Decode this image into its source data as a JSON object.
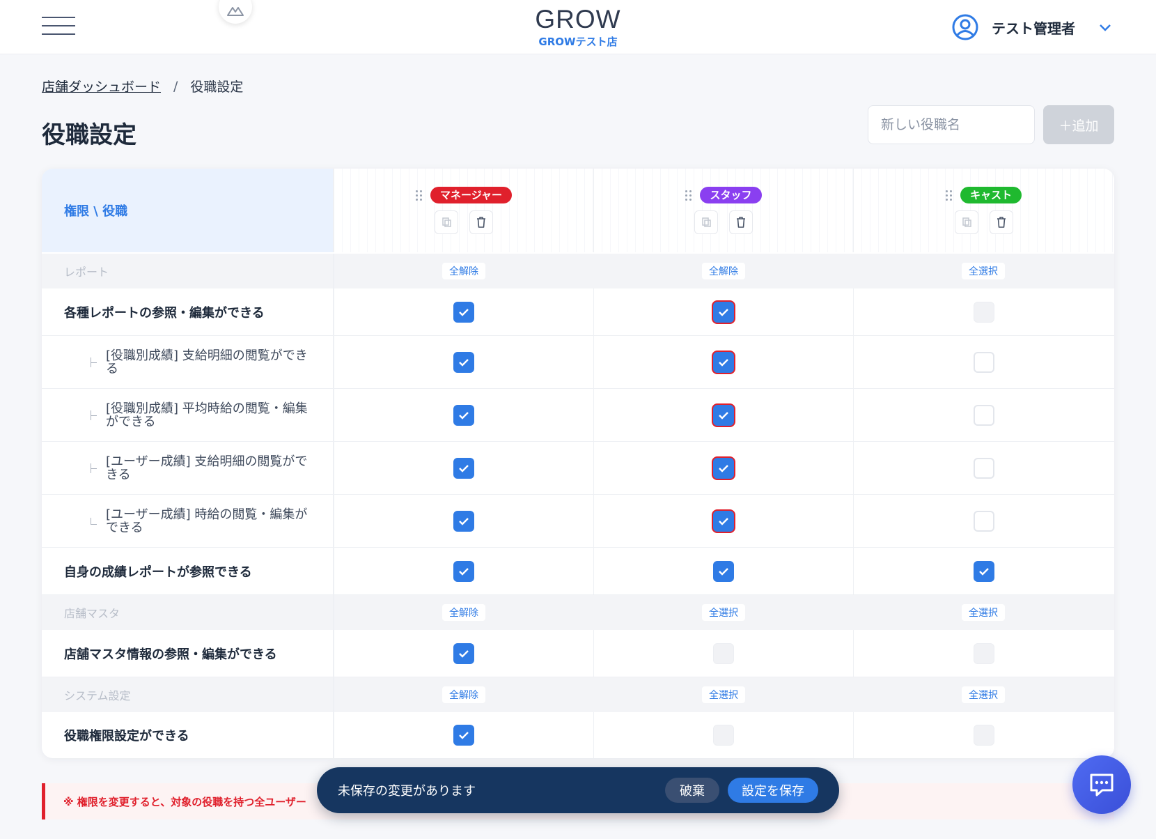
{
  "header": {
    "brand_name": "GROW",
    "store_name": "GROWテスト店",
    "user_name": "テスト管理者"
  },
  "breadcrumb": {
    "parent": "店舗ダッシュボード",
    "separator": "/",
    "current": "役職設定"
  },
  "page_title": "役職設定",
  "new_role": {
    "placeholder": "新しい役職名",
    "add_label": "＋追加"
  },
  "table": {
    "corner_label": "権限 \\ 役職",
    "roles": [
      {
        "name": "マネージャー",
        "color": "#e0202c"
      },
      {
        "name": "スタッフ",
        "color": "#8a3ff0"
      },
      {
        "name": "キャスト",
        "color": "#1fb92f"
      }
    ],
    "sections": [
      {
        "name": "レポート",
        "toggles": [
          "全解除",
          "全解除",
          "全選択"
        ],
        "permissions": [
          {
            "label": "各種レポートの参照・編集ができる",
            "checked": [
              true,
              true,
              false
            ]
          },
          {
            "label": "[役職別成績] 支給明細の閲覧ができる",
            "checked": [
              true,
              true,
              false
            ]
          },
          {
            "label": "[役職別成績] 平均時給の閲覧・編集ができる",
            "checked": [
              true,
              true,
              false
            ]
          },
          {
            "label": "[ユーザー成績] 支給明細の閲覧ができる",
            "checked": [
              true,
              true,
              false
            ]
          },
          {
            "label": "[ユーザー成績] 時給の閲覧・編集ができる",
            "checked": [
              true,
              true,
              false
            ]
          },
          {
            "label": "自身の成績レポートが参照できる",
            "checked": [
              true,
              true,
              true
            ]
          }
        ]
      },
      {
        "name": "店舗マスタ",
        "toggles": [
          "全解除",
          "全選択",
          "全選択"
        ],
        "permissions": [
          {
            "label": "店舗マスタ情報の参照・編集ができる",
            "checked": [
              true,
              false,
              false
            ]
          }
        ]
      },
      {
        "name": "システム設定",
        "toggles": [
          "全解除",
          "全選択",
          "全選択"
        ],
        "permissions": [
          {
            "label": "役職権限設定ができる",
            "checked": [
              true,
              false,
              false
            ]
          }
        ]
      }
    ]
  },
  "notice": "※ 権限を変更すると、対象の役職を持つ全ユーザー",
  "unsaved_bar": {
    "message": "未保存の変更があります",
    "discard_label": "破棄",
    "save_label": "設定を保存"
  },
  "colors": {
    "accent": "#2f7be5",
    "danger": "#e0202c",
    "bar_bg": "#163660"
  }
}
